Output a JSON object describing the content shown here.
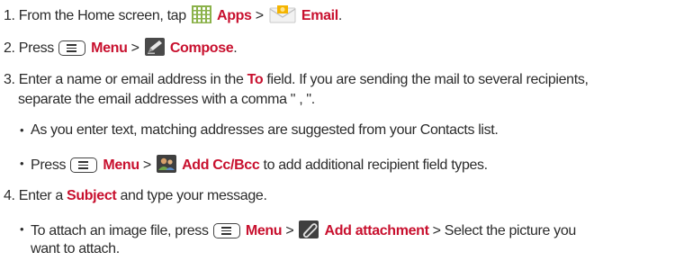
{
  "steps": [
    {
      "num": "1.",
      "before": "From the Home screen, tap",
      "apps_icon": "apps-grid-icon",
      "apps_label": "Apps",
      "sep": ">",
      "email_icon": "email-envelope-icon",
      "email_label": "Email",
      "after": "."
    },
    {
      "num": "2.",
      "before": "Press",
      "menu_icon": "menu-key-icon",
      "menu_label": "Menu",
      "sep": ">",
      "compose_icon": "compose-pen-icon",
      "compose_label": "Compose",
      "after": "."
    },
    {
      "num": "3.",
      "before": "Enter a name or email address in the",
      "to_label": "To",
      "after": "field. If you are sending the mail to several recipients,",
      "line2": "separate the email addresses with a comma \" , \"."
    },
    {
      "num": "4.",
      "before": "Enter a",
      "subject_label": "Subject",
      "after": "and type your message."
    }
  ],
  "bullets": [
    {
      "marker": "•",
      "text": "As you enter text, matching addresses are suggested from your Contacts list."
    },
    {
      "marker": "•",
      "before": "Press",
      "menu_icon": "menu-key-icon",
      "menu_label": "Menu",
      "sep": ">",
      "cc_icon": "add-contact-icon",
      "cc_label": "Add Cc/Bcc",
      "after": "to add additional recipient field types."
    },
    {
      "marker": "•",
      "before": "To attach an image file, press",
      "menu_icon": "menu-key-icon",
      "menu_label": "Menu",
      "sep": ">",
      "attach_icon": "paperclip-icon",
      "attach_label": "Add attachment",
      "after": "> Select the picture you",
      "line2": "want to attach."
    }
  ],
  "colors": {
    "accent": "#c8102e",
    "text": "#2b2b2b"
  }
}
